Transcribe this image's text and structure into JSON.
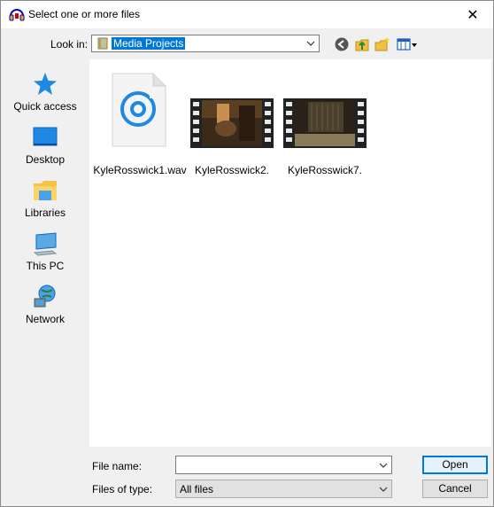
{
  "window": {
    "title": "Select one or more files",
    "close_glyph": "✕"
  },
  "toolbar": {
    "look_in_label": "Look in:",
    "look_in_value": "Media Projects",
    "icons": [
      "back-icon",
      "up-folder-icon",
      "new-folder-icon",
      "view-menu-icon"
    ]
  },
  "places": [
    {
      "label": "Quick access",
      "icon": "quick-access-star-icon"
    },
    {
      "label": "Desktop",
      "icon": "desktop-icon"
    },
    {
      "label": "Libraries",
      "icon": "libraries-icon"
    },
    {
      "label": "This PC",
      "icon": "this-pc-icon"
    },
    {
      "label": "Network",
      "icon": "network-icon"
    }
  ],
  "files": [
    {
      "name": "KyleRosswick1.wav",
      "icon": "audio-file-icon"
    },
    {
      "name": "KyleRosswick2.",
      "icon": "video-thumbnail-icon"
    },
    {
      "name": "KyleRosswick7.",
      "icon": "video-thumbnail-icon"
    }
  ],
  "form": {
    "file_name_label": "File name:",
    "file_name_value": "",
    "files_of_type_label": "Files of type:",
    "files_of_type_value": "All files"
  },
  "buttons": {
    "open": "Open",
    "cancel": "Cancel"
  },
  "colors": {
    "selection": "#0078d7",
    "accent_icon": "#1e88e5"
  }
}
